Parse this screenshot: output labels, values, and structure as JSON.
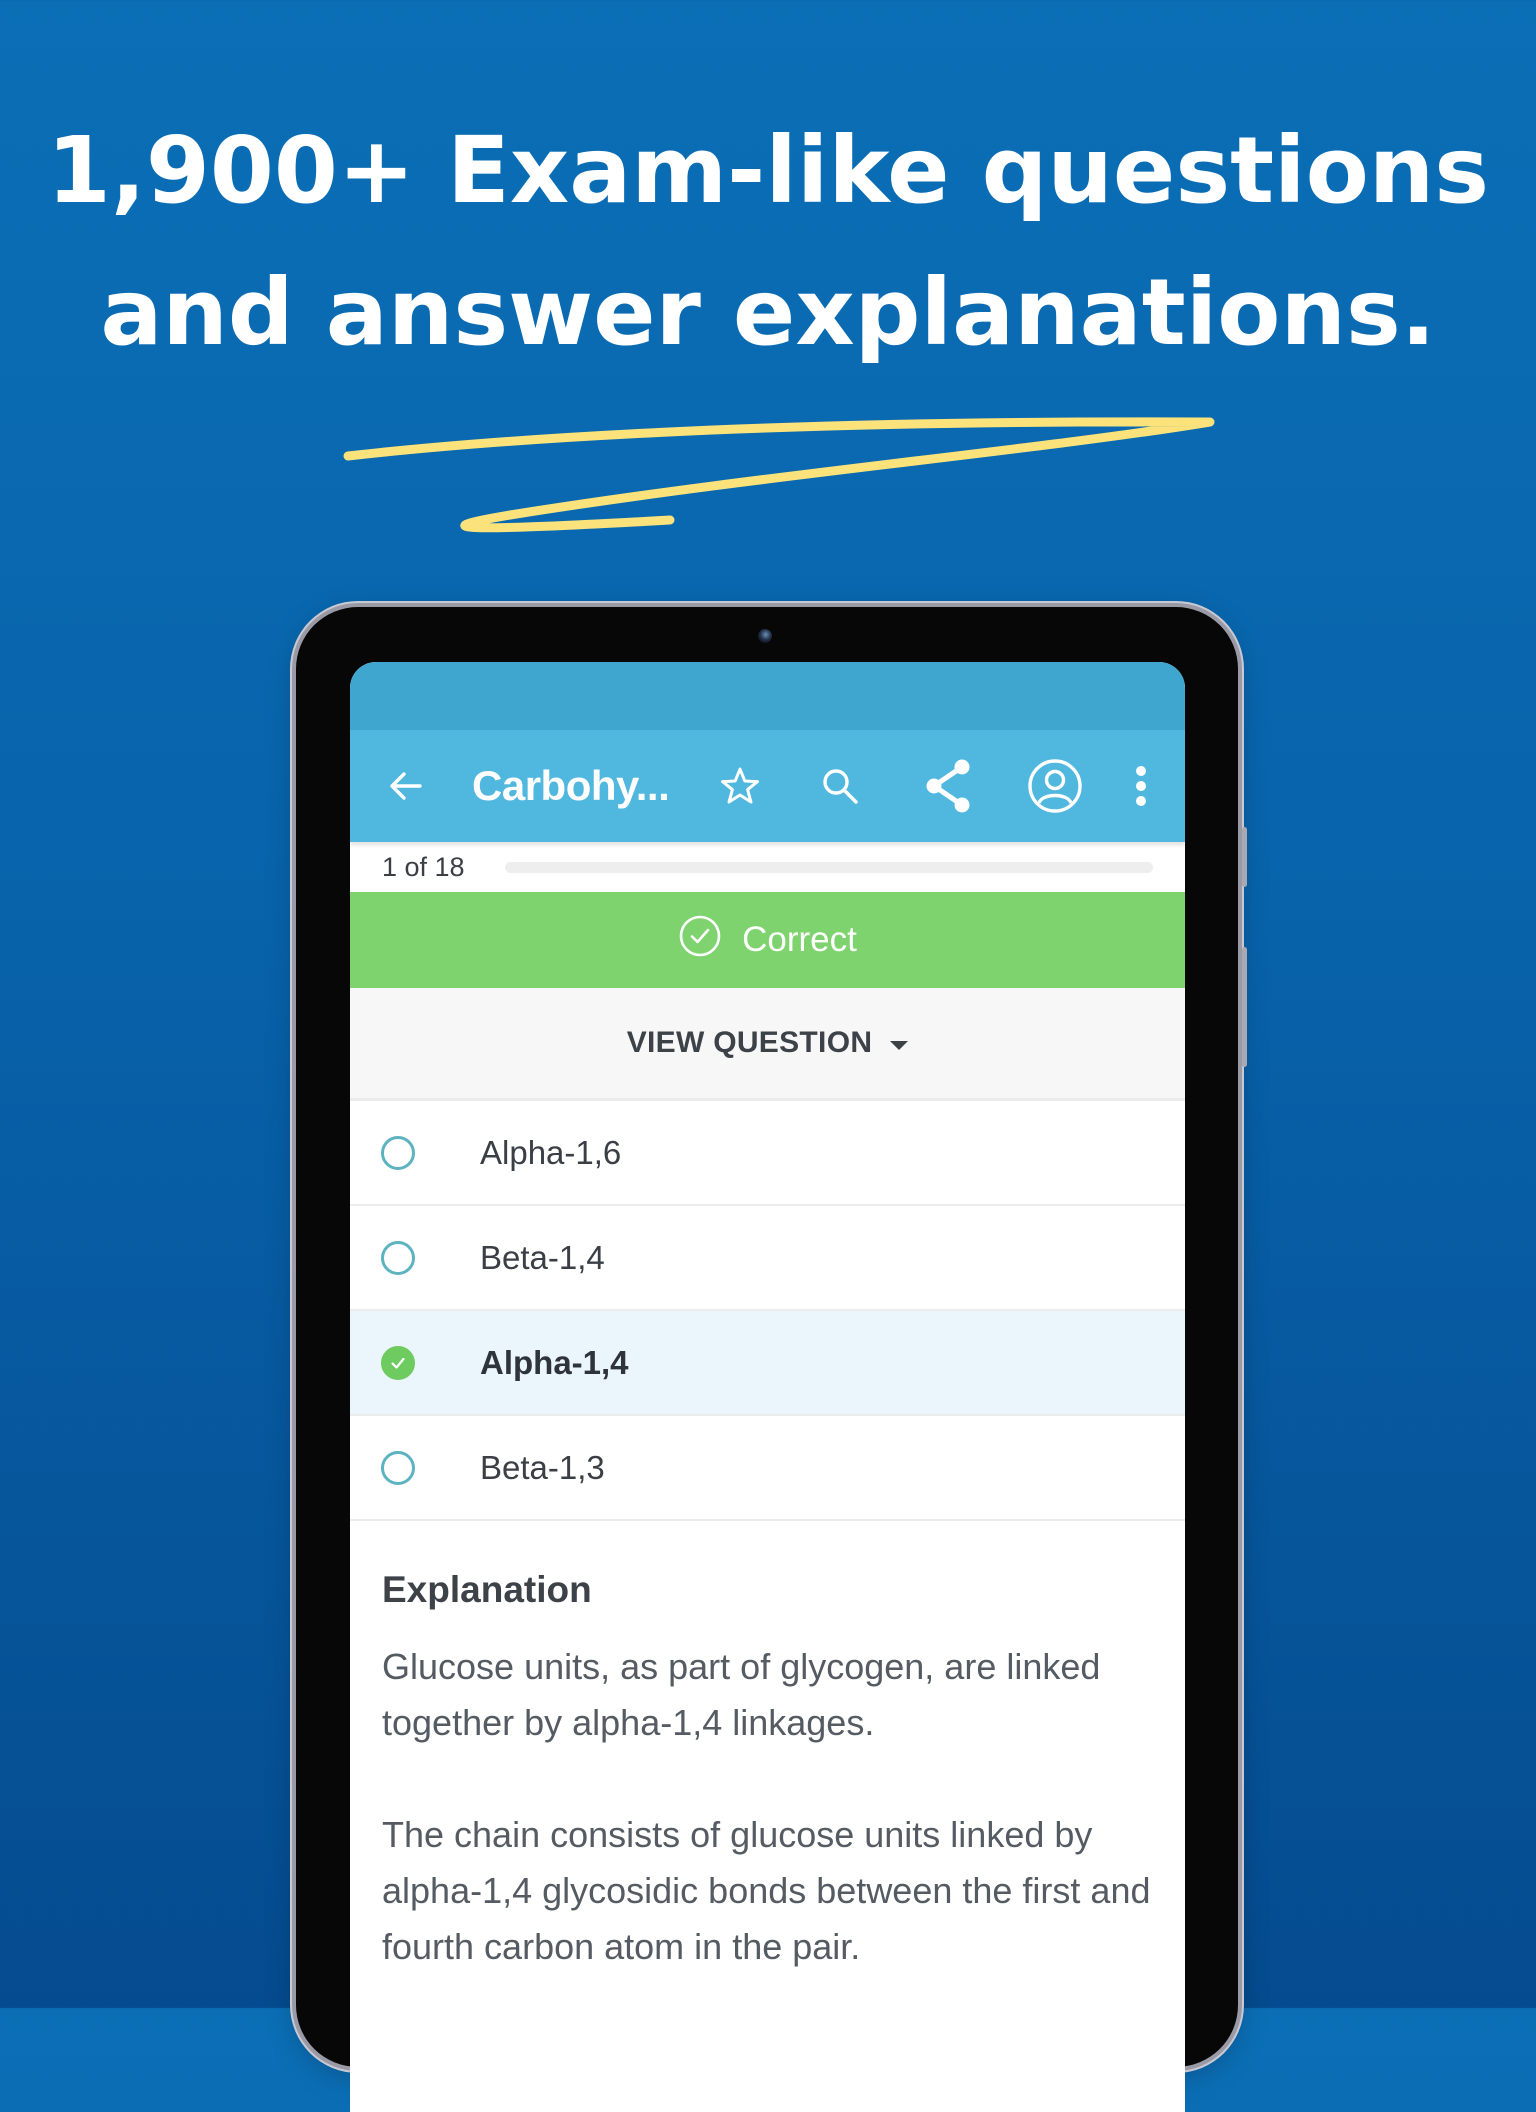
{
  "promo": {
    "headline_line1": "1,900+ Exam-like questions",
    "headline_line2": "and answer explanations.",
    "accent_color": "#fbe27a",
    "background_color_top": "#0b6fb6",
    "background_color_bottom": "#054b8f"
  },
  "app": {
    "toolbar": {
      "back_icon": "arrow-left-icon",
      "title": "Carbohy...",
      "actions": [
        {
          "name": "bookmark",
          "icon": "star-outline-icon"
        },
        {
          "name": "search",
          "icon": "search-icon"
        },
        {
          "name": "share",
          "icon": "share-icon"
        },
        {
          "name": "account",
          "icon": "account-circle-icon"
        },
        {
          "name": "more",
          "icon": "more-vertical-icon"
        }
      ],
      "color": "#50b7de"
    },
    "progress": {
      "label": "1 of 18",
      "current": 1,
      "total": 18,
      "fraction": 0.0
    },
    "result_banner": {
      "icon": "check-circle-outline-icon",
      "label": "Correct",
      "color": "#7ed36f"
    },
    "view_question": {
      "label": "VIEW QUESTION",
      "icon": "caret-down-icon"
    },
    "options": [
      {
        "label": "Alpha-1,6",
        "selected": false
      },
      {
        "label": "Beta-1,4",
        "selected": false
      },
      {
        "label": "Alpha-1,4",
        "selected": true
      },
      {
        "label": "Beta-1,3",
        "selected": false
      }
    ],
    "explanation": {
      "title": "Explanation",
      "paragraphs": [
        "Glucose units, as part of glycogen, are linked together by alpha-1,4 linkages.",
        "The chain consists of glucose units linked by alpha-1,4 glycosidic bonds between the first and fourth carbon atom in the pair."
      ]
    }
  }
}
